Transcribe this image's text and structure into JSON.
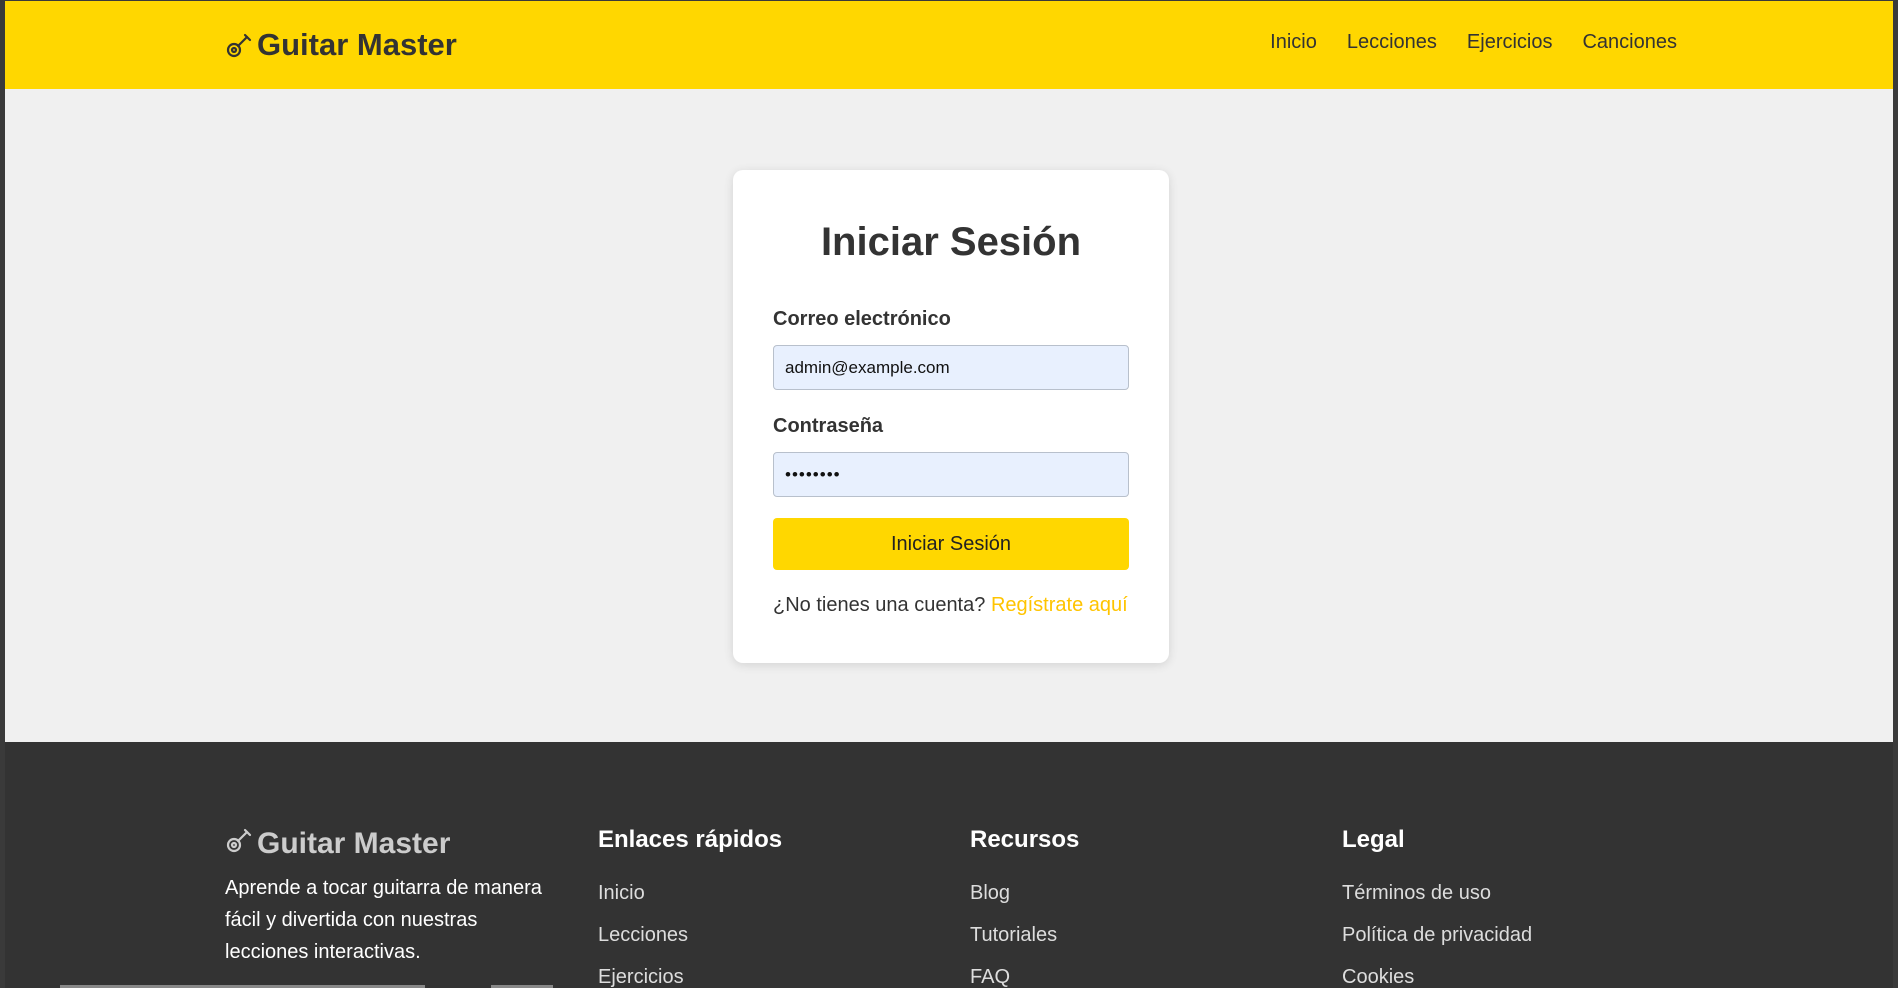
{
  "header": {
    "brand": "Guitar Master",
    "nav": [
      "Inicio",
      "Lecciones",
      "Ejercicios",
      "Canciones"
    ]
  },
  "login": {
    "title": "Iniciar Sesión",
    "email_label": "Correo electrónico",
    "email_value": "admin@example.com",
    "password_label": "Contraseña",
    "password_value": "admin123",
    "submit_label": "Iniciar Sesión",
    "signup_prompt": "¿No tienes una cuenta?",
    "signup_link": "Regístrate aquí"
  },
  "footer": {
    "brand": "Guitar Master",
    "description": "Aprende a tocar guitarra de manera fácil y divertida con nuestras lecciones interactivas.",
    "quick_links": {
      "title": "Enlaces rápidos",
      "items": [
        "Inicio",
        "Lecciones",
        "Ejercicios"
      ]
    },
    "resources": {
      "title": "Recursos",
      "items": [
        "Blog",
        "Tutoriales",
        "FAQ"
      ]
    },
    "legal": {
      "title": "Legal",
      "items": [
        "Términos de uso",
        "Política de privacidad",
        "Cookies"
      ]
    }
  },
  "colors": {
    "accent": "#ffd700",
    "link": "#ffc400",
    "footer_bg": "#333333",
    "page_bg": "#f0f0f0"
  }
}
